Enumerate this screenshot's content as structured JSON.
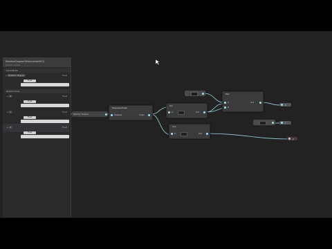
{
  "blackboard": {
    "title": "RotationDegreeOfNormalizedV12",
    "subtitle": "Shader Graph",
    "section_input": "Input Node",
    "prop_main": "Rotation Degree",
    "prop_main_scope": "Float",
    "default_label": "Float",
    "section_output": "Output Node",
    "props": [
      {
        "name": "X",
        "scope": "Float"
      },
      {
        "name": "Y",
        "scope": "Float"
      },
      {
        "name": "Z",
        "scope": "Float"
      }
    ]
  },
  "graph": {
    "property_pill": "Rotation Degree",
    "degrees_node": {
      "title": "Degrees/Angle",
      "in": "Degrees",
      "out": "Angle"
    },
    "sin_node": {
      "title": "Sin",
      "in": "In",
      "out": "Out"
    },
    "cos_node": {
      "title": "Cos",
      "in": "In",
      "out": "Out"
    },
    "mul_node": {
      "title": "Mul",
      "in_a": "A",
      "in_b": "B",
      "out": "Out"
    },
    "outputs": [
      "X",
      "Y",
      "Z"
    ]
  }
}
